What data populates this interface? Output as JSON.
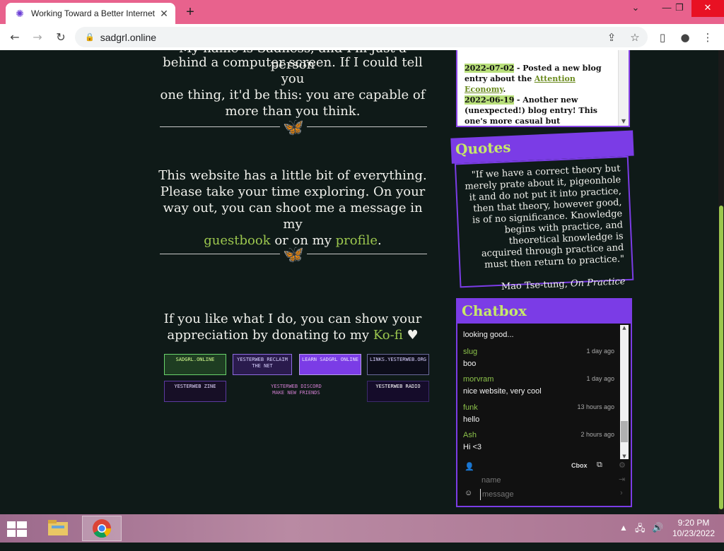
{
  "browser": {
    "tab_title": "Working Toward a Better Internet",
    "url": "sadgrl.online",
    "colors": {
      "tabbar": "#e8628d",
      "accent": "#7b3ce6",
      "link_green": "#9cc74e"
    }
  },
  "main": {
    "intro_partial": "My name is Sadness, and I'm just a person",
    "intro": [
      "behind a computer screen. If I could tell you",
      "one thing, it'd be this: you are capable of",
      "more than you think."
    ],
    "explore": [
      "This website has a little bit of everything.",
      "Please take your time exploring. On your",
      "way out, you can shoot me a message in my"
    ],
    "guestbook": "guestbook",
    "or_on_my": "or on my",
    "profile": "profile",
    "period": ".",
    "donate_line1": "If you like what I do, you can show your",
    "donate_line2_pre": "appreciation by donating to my",
    "kofi": "Ko-fi",
    "heart": "♥",
    "badges": [
      {
        "name": "sadgrl-online",
        "text": "SADGRL.ONLINE"
      },
      {
        "name": "yesterweb-reclaim",
        "text": "YESTERWEB RECLAIM THE NET"
      },
      {
        "name": "learn-sadgrl",
        "text": "LEARN SADGRL ONLINE"
      },
      {
        "name": "links-yesterweb",
        "text": "LINKS.YESTERWEB.ORG"
      },
      {
        "name": "yesterweb-zine",
        "text": "YESTERWEB ZINE"
      },
      {
        "name": "yesterweb-discord",
        "text": "YESTERWEB DISCORD MAKE NEW FRIENDS"
      },
      {
        "name": "yesterweb-radio",
        "text": "YESTERWEB RADIO"
      }
    ]
  },
  "updates": [
    {
      "date": "2022-07-02",
      "text_pre": "- Posted a new blog entry about the",
      "link": "Attention Economy",
      "text_post": "."
    },
    {
      "date": "2022-06-19",
      "text_pre": "- Another new (unexpected!) blog entry! This one's more casual but",
      "link": "",
      "text_post": ""
    }
  ],
  "quotes": {
    "title": "Quotes",
    "text": "\"If we have a correct theory but merely prate about it, pigeonhole it and do not put it into practice, then that theory, however good, is of no significance. Knowledge begins with practice, and theoretical knowledge is acquired through practice and must then return to practice.\"",
    "author": "Mao Tse-tung,",
    "work": "On Practice"
  },
  "chatbox": {
    "title": "Chatbox",
    "partial_message": "looking good...",
    "messages": [
      {
        "name": "slug",
        "time": "1 day ago",
        "body": "boo"
      },
      {
        "name": "morvram",
        "time": "1 day ago",
        "body": "nice website, very cool"
      },
      {
        "name": "funk",
        "time": "13 hours ago",
        "body": "hello"
      },
      {
        "name": "Ash",
        "time": "2 hours ago",
        "body": "Hi <3"
      }
    ],
    "brand": "Cbox",
    "name_placeholder": "name",
    "message_placeholder": "message"
  },
  "taskbar": {
    "time": "9:20 PM",
    "date": "10/23/2022"
  }
}
